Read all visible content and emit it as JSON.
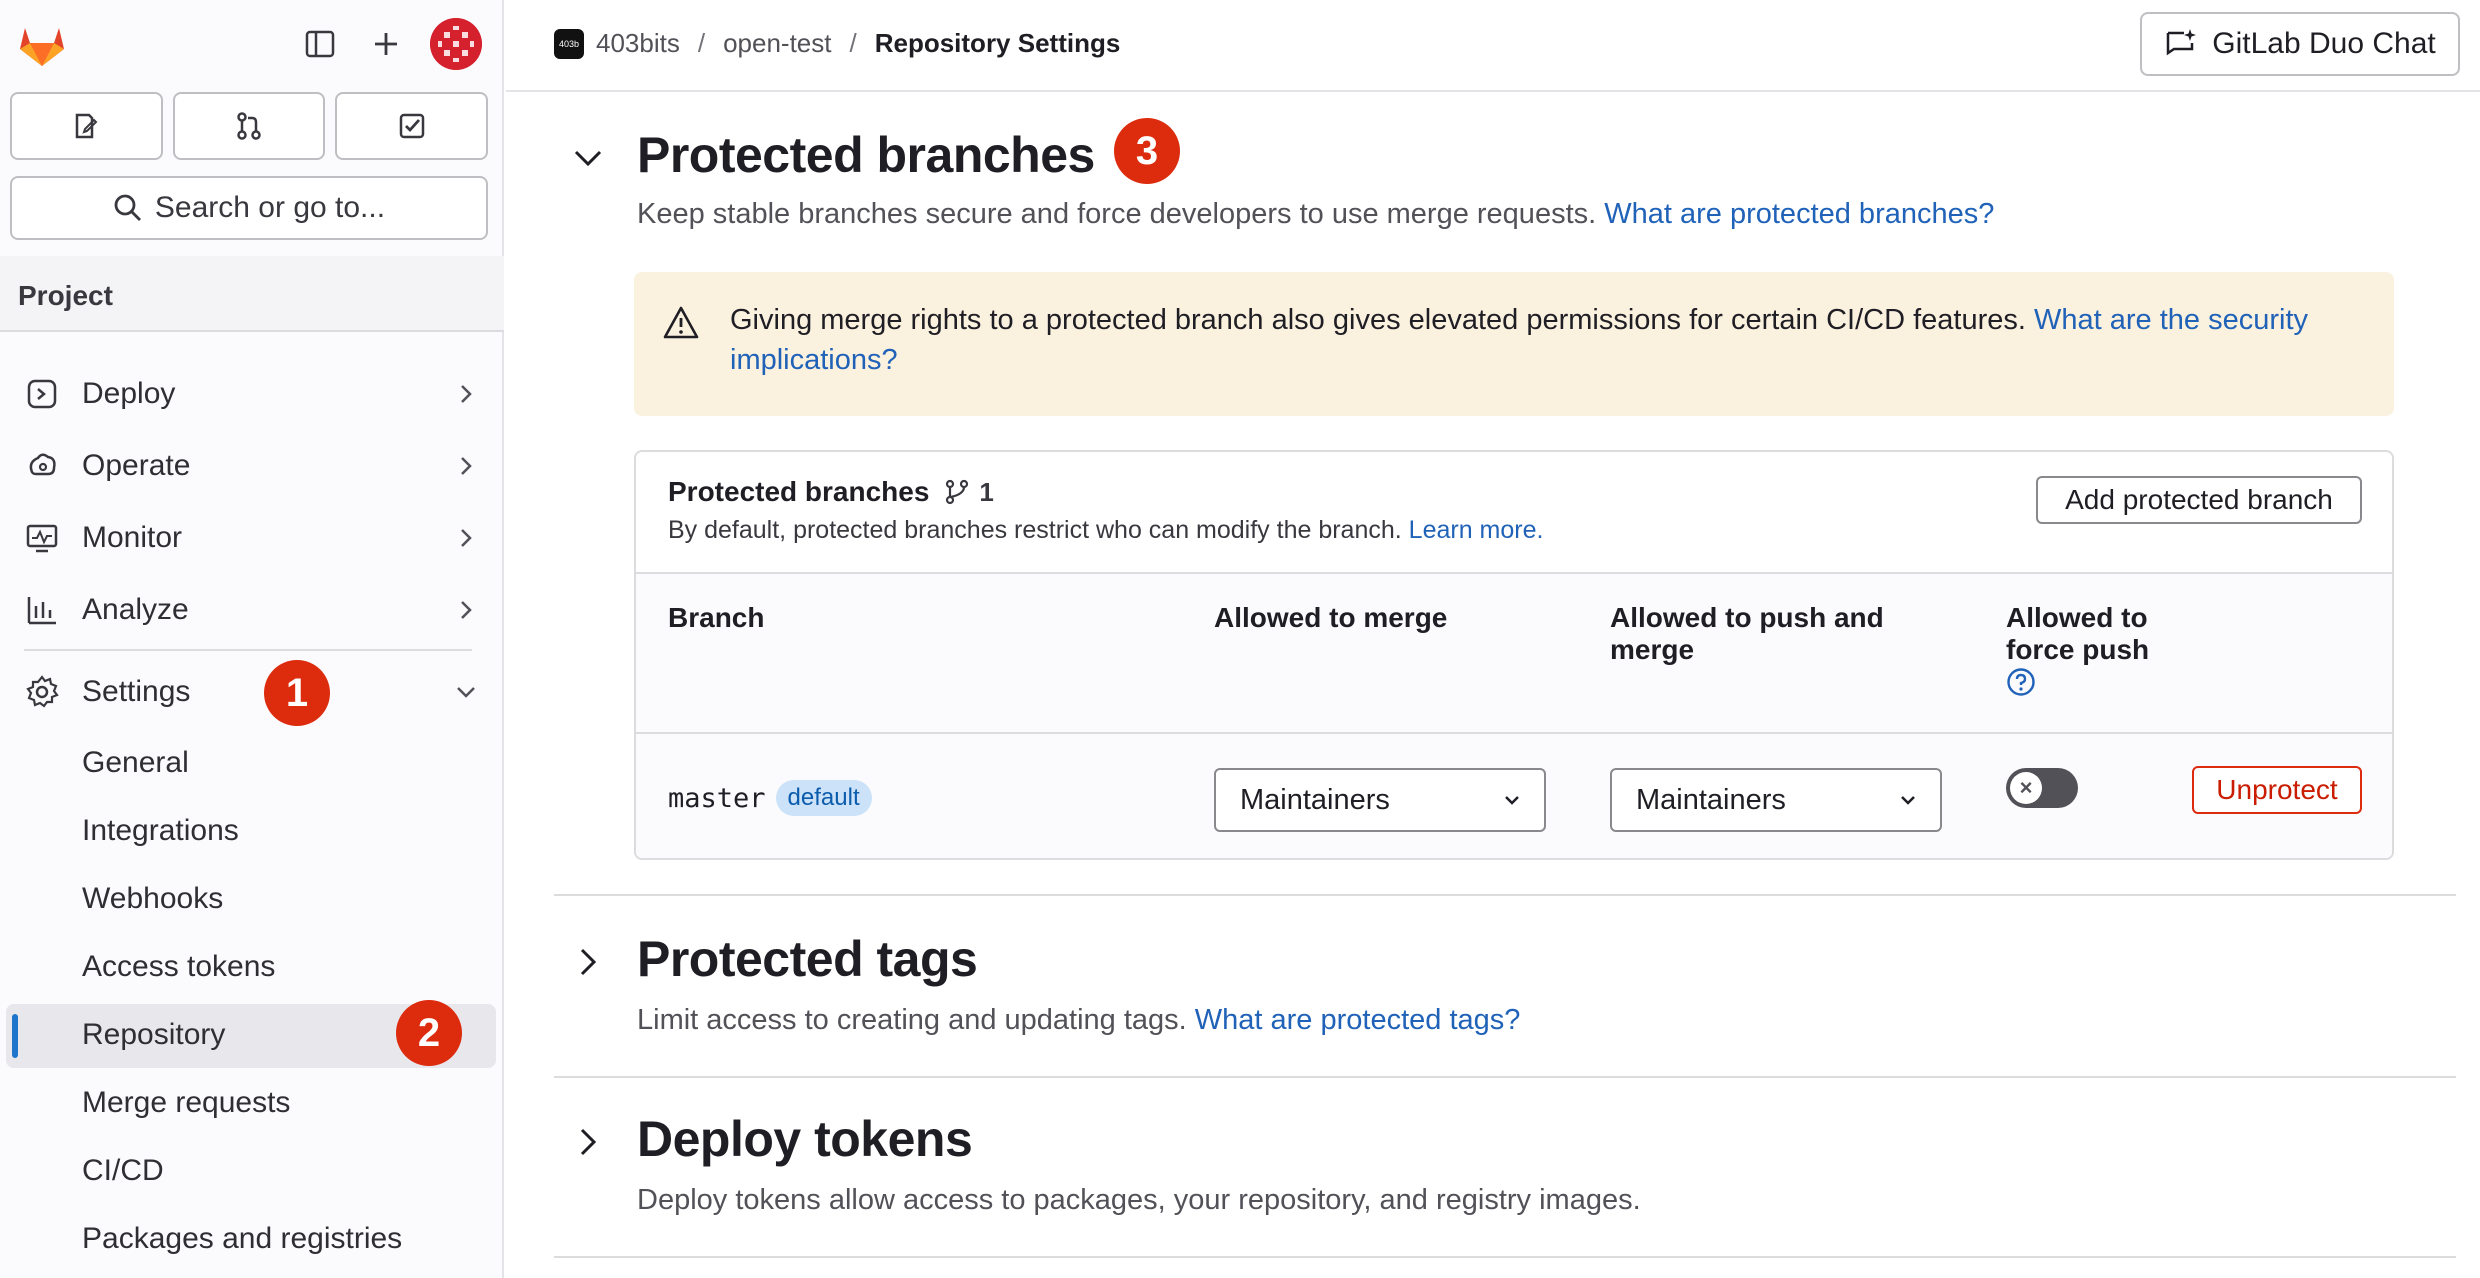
{
  "sidebar": {
    "search_label": "Search or go to...",
    "section_title": "Project",
    "nav": [
      {
        "label": "Deploy",
        "icon": "deploy-icon"
      },
      {
        "label": "Operate",
        "icon": "operate-icon"
      },
      {
        "label": "Monitor",
        "icon": "monitor-icon"
      },
      {
        "label": "Analyze",
        "icon": "analyze-icon"
      },
      {
        "label": "Settings",
        "icon": "settings-icon"
      }
    ],
    "settings_sub": [
      "General",
      "Integrations",
      "Webhooks",
      "Access tokens",
      "Repository",
      "Merge requests",
      "CI/CD",
      "Packages and registries"
    ]
  },
  "markers": {
    "m1": "1",
    "m2": "2",
    "m3": "3"
  },
  "breadcrumb": {
    "group_avatar": "403b",
    "group": "403bits",
    "project": "open-test",
    "current": "Repository Settings"
  },
  "duo_chat_label": "GitLab Duo Chat",
  "protected_branches": {
    "title": "Protected branches",
    "desc": "Keep stable branches secure and force developers to use merge requests.",
    "desc_link": "What are protected branches?",
    "warning_text": "Giving merge rights to a protected branch also gives elevated permissions for certain CI/CD features.",
    "warning_link": "What are the security implications?",
    "card": {
      "title": "Protected branches",
      "count": "1",
      "desc": "By default, protected branches restrict who can modify the branch.",
      "desc_link": "Learn more.",
      "add_button": "Add protected branch",
      "columns": {
        "branch": "Branch",
        "merge": "Allowed to merge",
        "push_merge": "Allowed to push and merge",
        "force_push": "Allowed to force push"
      },
      "row": {
        "branch": "master",
        "badge": "default",
        "merge_value": "Maintainers",
        "push_value": "Maintainers",
        "unprotect": "Unprotect"
      }
    }
  },
  "protected_tags": {
    "title": "Protected tags",
    "desc": "Limit access to creating and updating tags.",
    "desc_link": "What are protected tags?"
  },
  "deploy_tokens": {
    "title": "Deploy tokens",
    "desc": "Deploy tokens allow access to packages, your repository, and registry images."
  },
  "colors": {
    "accent": "#1f62b8",
    "danger": "#dd2b0e",
    "warning_bg": "#fbf1df"
  }
}
